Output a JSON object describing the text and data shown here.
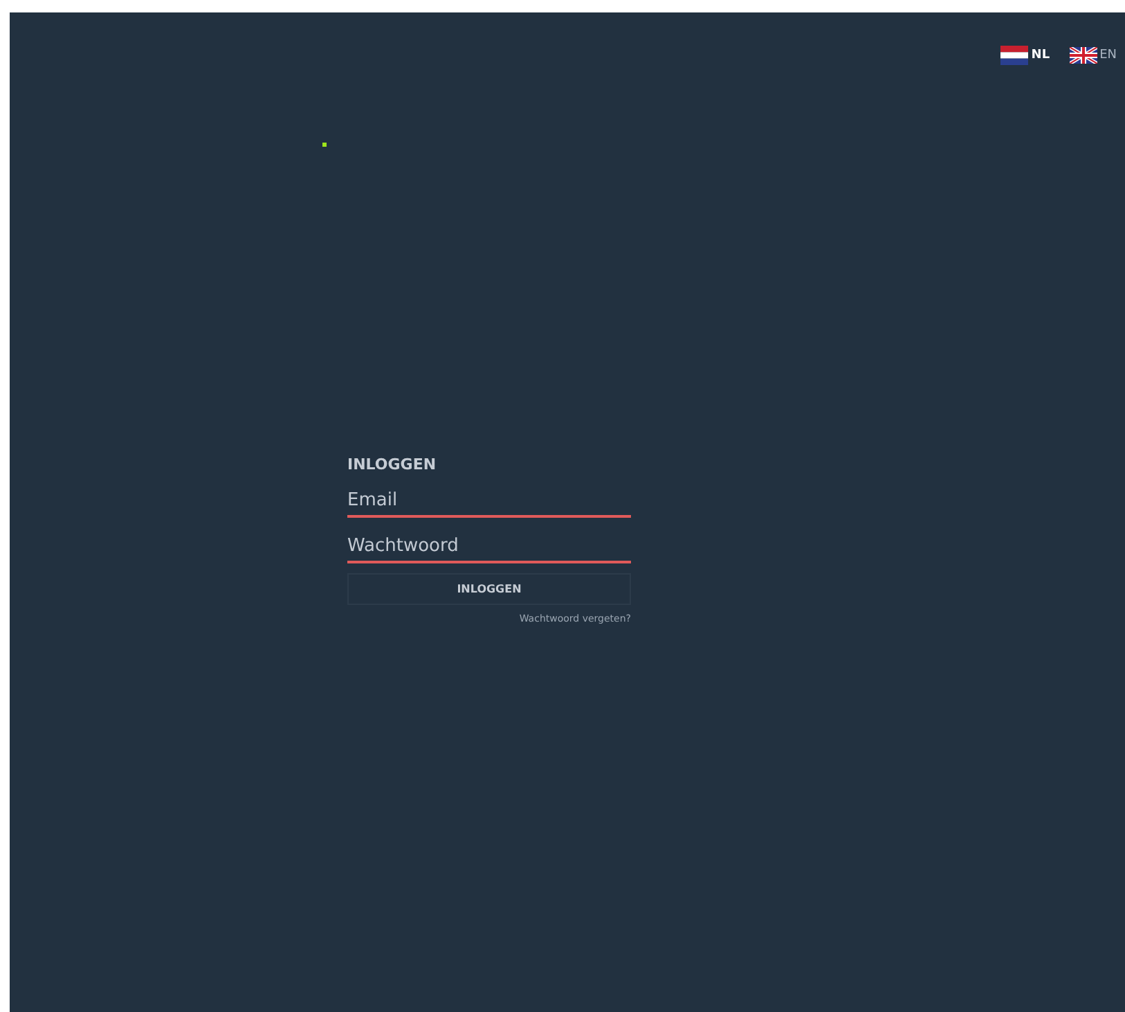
{
  "languages": [
    {
      "code": "NL",
      "kind": "nl",
      "selected": true
    },
    {
      "code": "EN",
      "kind": "gb",
      "selected": false
    }
  ],
  "login": {
    "title": "INLOGGEN",
    "email": {
      "placeholder": "Email"
    },
    "password": {
      "placeholder": "Wachtwoord"
    },
    "button": "INLOGGEN",
    "forgot_link": "Wachtwoord vergeten?"
  }
}
